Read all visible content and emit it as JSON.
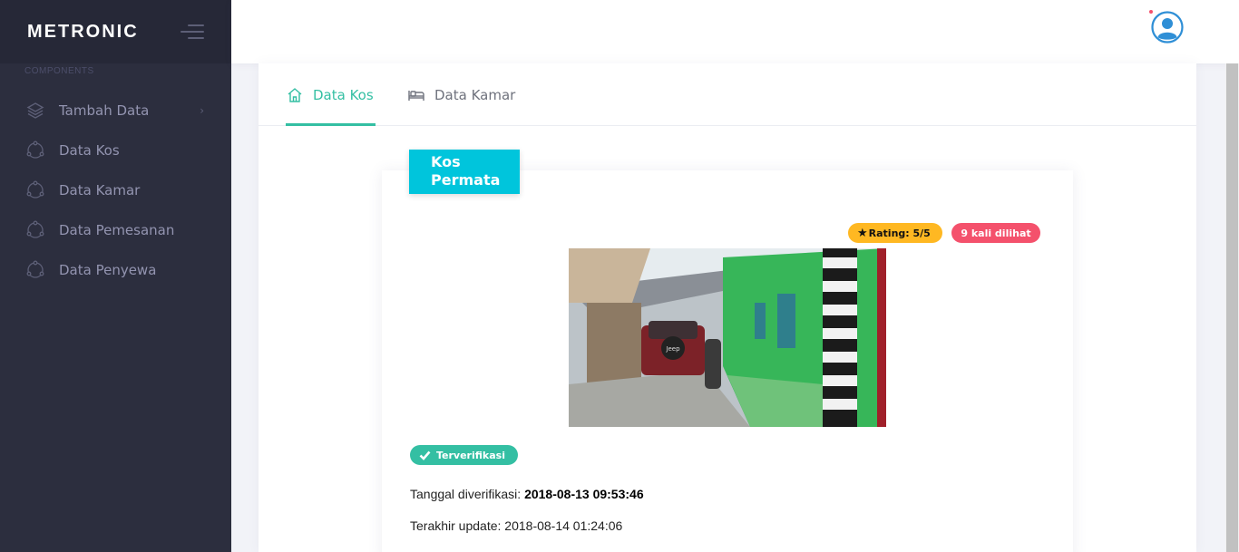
{
  "brand": {
    "name": "METRONIC"
  },
  "sidebar": {
    "section_label": "COMPONENTS",
    "items": [
      {
        "label": "Tambah Data",
        "icon": "layers-icon",
        "has_submenu": true
      },
      {
        "label": "Data Kos",
        "icon": "circle-dots-icon"
      },
      {
        "label": "Data Kamar",
        "icon": "circle-dots-icon"
      },
      {
        "label": "Data Pemesanan",
        "icon": "circle-dots-icon"
      },
      {
        "label": "Data Penyewa",
        "icon": "circle-dots-icon"
      }
    ]
  },
  "topbar": {
    "avatar_icon": "user-avatar-icon"
  },
  "tabs": [
    {
      "label": "Data Kos",
      "icon": "home-icon",
      "active": true
    },
    {
      "label": "Data Kamar",
      "icon": "bed-icon",
      "active": false
    }
  ],
  "kos": {
    "name_line1": "Kos",
    "name_line2": "Permata",
    "rating": "Rating: 5/5",
    "views": "9 kali dilihat",
    "verified": "Terverifikasi",
    "verified_label": "Tanggal diverifikasi:",
    "verified_date": "2018-08-13 09:53:46",
    "updated_label": "Terakhir update:",
    "updated_date": "2018-08-14 01:24:06"
  },
  "colors": {
    "sidebar_bg": "#2c2e3e",
    "accent": "#34bfa3",
    "ribbon": "#00c5dc",
    "rating": "#ffb822",
    "views": "#f4516c"
  }
}
